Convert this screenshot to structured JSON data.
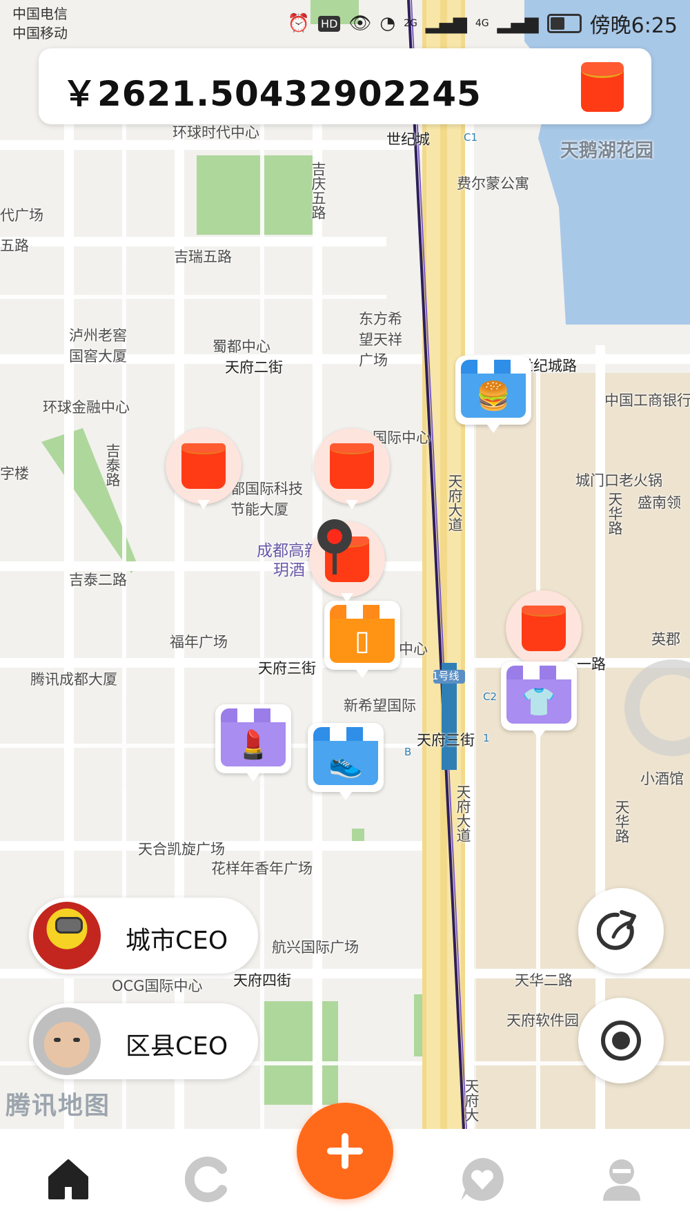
{
  "status_bar": {
    "carrier_1": "中国电信",
    "carrier_2": "中国移动",
    "time": "傍晚6:25",
    "hd": "HD",
    "net_2g": "2G",
    "net_4g": "4G"
  },
  "balance": {
    "amount": "￥2621.50432902245"
  },
  "map": {
    "attribution": "腾讯地图",
    "labels": {
      "huanqiu_shidai": "环球时代中心",
      "shijicheng": "世纪城",
      "feiermeng": "费尔蒙公寓",
      "tianehu": "天鹅湖花园",
      "jiqingwulu": "吉庆五路",
      "dai_guangchang": "代广场",
      "wulu": "五路",
      "jiruiwulu": "吉瑞五路",
      "dongfang_xiwang": "东方希望天祥广场",
      "luzhou_laojiao": "泸州老窖国窖大厦",
      "shudu_zhongxin": "蜀都中心",
      "tianfu_erjie": "天府二街",
      "shijichenglu": "世纪城路",
      "gongshang": "中国工商银行",
      "huanqiu_jinrong": "环球金融中心",
      "guoji_zhongxin": "国际中心",
      "chengdu_guoji": "都国际科技节能大厦",
      "jitai_lu": "吉泰路",
      "zilou": "字楼",
      "chengmen": "城门口老火锅",
      "tianhualu_1": "天华路",
      "shengnan": "盛南领",
      "tianfu_dadao_1": "天府大道",
      "chengdu_gaoxin": "成都高新",
      "yue_jiu": "玥酒",
      "jitai_erlu": "吉泰二路",
      "funian": "福年广场",
      "yingjun": "英郡",
      "zhongxin_short": "中心",
      "yilu": "一路",
      "tengxun": "腾讯成都大厦",
      "tianfu_sanjie": "天府三街",
      "xinxiwang": "新希望国际",
      "tianfu_sanjie_2": "天府三街",
      "line1": "1号线",
      "xiaojiuguan": "小酒馆",
      "tianfu_dadao_2": "天府大道",
      "tianhualu_2": "天华路",
      "tianhe_kaixuan": "天合凯旋广场",
      "huayang_nian": "花样年香年广场",
      "hangxing": "航兴国际广场",
      "ocg": "OCG国际中心",
      "tianfu_sijie": "天府四街",
      "tianhua_erlu": "天华二路",
      "tianfu_ruanjian": "天府软件园",
      "tianfu_da": "天府大"
    },
    "metro_exits": [
      "C1",
      "C2",
      "B",
      "1"
    ]
  },
  "ceo_buttons": {
    "city": "城市CEO",
    "county": "区县CEO"
  },
  "colors": {
    "accent": "#ff6a1a",
    "red_packet": "#ff3b16",
    "tab_active": "#222222",
    "tab_inactive": "#c9c9c9"
  },
  "icons": {
    "redpack": "red-packet-icon",
    "share": "share-icon",
    "locate": "locate-icon",
    "home": "home-icon",
    "circle": "c-icon",
    "add": "plus-icon",
    "messages": "heart-chat-icon",
    "profile": "profile-icon"
  }
}
